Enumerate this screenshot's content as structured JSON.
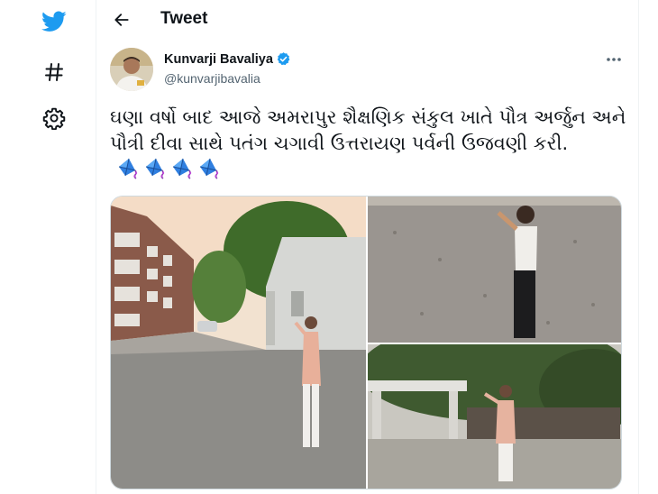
{
  "header": {
    "title": "Tweet"
  },
  "nav": {
    "icons": [
      "twitter-bird-icon",
      "hashtag-icon",
      "settings-gear-icon"
    ]
  },
  "author": {
    "name": "Kunvarji Bavaliya",
    "handle": "@kunvarjibavalia",
    "verified": true
  },
  "tweet": {
    "text": "ઘણા વર્ષો બાદ આજે અમરાપુર શૈક્ષણિક સંકુલ ખાતે પૌત્ર અર્જુન અને પૌત્રી દીવા સાથે પતંગ ચગાવી ઉત્તરાયણ પર્વની ઉજવણી કરી.",
    "emoji_count": 4,
    "emoji": "kite-emoji"
  },
  "media": {
    "photo_count": 3,
    "photos": [
      "man-flying-kite-courtyard",
      "boy-flying-kite",
      "man-flying-kite-trees"
    ]
  },
  "colors": {
    "brand_blue": "#1d9bf0",
    "text_primary": "#0f1419",
    "text_secondary": "#536471",
    "border": "#cfd9de"
  }
}
